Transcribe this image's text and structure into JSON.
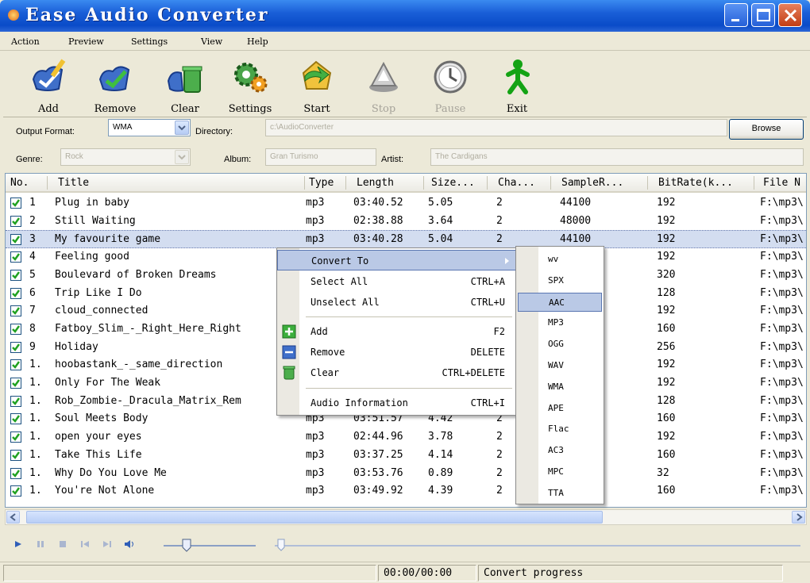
{
  "window": {
    "title": "Ease Audio Converter"
  },
  "menu": [
    "Action",
    "Preview",
    "Settings",
    "View",
    "Help"
  ],
  "toolbar": [
    {
      "label": "Add",
      "icon": "add-icon",
      "enabled": true
    },
    {
      "label": "Remove",
      "icon": "remove-icon",
      "enabled": true
    },
    {
      "label": "Clear",
      "icon": "clear-icon",
      "enabled": true
    },
    {
      "label": "Settings",
      "icon": "settings-icon",
      "enabled": true
    },
    {
      "label": "Start",
      "icon": "start-icon",
      "enabled": true
    },
    {
      "label": "Stop",
      "icon": "stop-icon",
      "enabled": false
    },
    {
      "label": "Pause",
      "icon": "pause-icon",
      "enabled": false
    },
    {
      "label": "Exit",
      "icon": "exit-icon",
      "enabled": true
    }
  ],
  "format": {
    "output_label": "Output Format:",
    "output_value": "WMA",
    "directory_label": "Directory:",
    "directory_value": "c:\\AudioConverter",
    "browse_label": "Browse"
  },
  "tags": {
    "genre_label": "Genre:",
    "genre_value": "Rock",
    "album_label": "Album:",
    "album_value": "Gran Turismo",
    "artist_label": "Artist:",
    "artist_value": "The Cardigans"
  },
  "table": {
    "columns": [
      "No.",
      "Title",
      "Type",
      "Length",
      "Size...",
      "Cha...",
      "SampleR...",
      "BitRate(k...",
      "File N"
    ],
    "rows": [
      {
        "no": "1",
        "title": "Plug in baby",
        "type": "mp3",
        "length": "03:40.52",
        "size": "5.05",
        "ch": "2",
        "sr": "44100",
        "br": "192",
        "file": "F:\\mp3\\"
      },
      {
        "no": "2",
        "title": "Still Waiting",
        "type": "mp3",
        "length": "02:38.88",
        "size": "3.64",
        "ch": "2",
        "sr": "48000",
        "br": "192",
        "file": "F:\\mp3\\"
      },
      {
        "no": "3",
        "title": "My favourite game",
        "type": "mp3",
        "length": "03:40.28",
        "size": "5.04",
        "ch": "2",
        "sr": "44100",
        "br": "192",
        "file": "F:\\mp3\\"
      },
      {
        "no": "4",
        "title": "Feeling good",
        "type": "",
        "length": "",
        "size": "",
        "ch": "",
        "sr": "",
        "br": "192",
        "file": "F:\\mp3\\"
      },
      {
        "no": "5",
        "title": "Boulevard of Broken Dreams",
        "type": "",
        "length": "",
        "size": "",
        "ch": "",
        "sr": "",
        "br": "320",
        "file": "F:\\mp3\\"
      },
      {
        "no": "6",
        "title": "Trip Like I Do",
        "type": "",
        "length": "",
        "size": "",
        "ch": "",
        "sr": "",
        "br": "128",
        "file": "F:\\mp3\\"
      },
      {
        "no": "7",
        "title": "cloud_connected",
        "type": "",
        "length": "",
        "size": "",
        "ch": "",
        "sr": "",
        "br": "192",
        "file": "F:\\mp3\\"
      },
      {
        "no": "8",
        "title": "Fatboy_Slim_-_Right_Here_Right",
        "type": "",
        "length": "",
        "size": "",
        "ch": "",
        "sr": "",
        "br": "160",
        "file": "F:\\mp3\\"
      },
      {
        "no": "9",
        "title": "Holiday",
        "type": "",
        "length": "",
        "size": "",
        "ch": "",
        "sr": "",
        "br": "256",
        "file": "F:\\mp3\\"
      },
      {
        "no": "1.",
        "title": "hoobastank_-_same_direction",
        "type": "",
        "length": "",
        "size": "",
        "ch": "",
        "sr": "",
        "br": "192",
        "file": "F:\\mp3\\"
      },
      {
        "no": "1.",
        "title": "Only For The Weak",
        "type": "",
        "length": "",
        "size": "",
        "ch": "",
        "sr": "",
        "br": "192",
        "file": "F:\\mp3\\"
      },
      {
        "no": "1.",
        "title": "Rob_Zombie-_Dracula_Matrix_Rem",
        "type": "",
        "length": "",
        "size": "",
        "ch": "",
        "sr": "",
        "br": "128",
        "file": "F:\\mp3\\"
      },
      {
        "no": "1.",
        "title": "Soul Meets Body",
        "type": "mp3",
        "length": "03:51.57",
        "size": "4.42",
        "ch": "2",
        "sr": "",
        "br": "160",
        "file": "F:\\mp3\\"
      },
      {
        "no": "1.",
        "title": "open your eyes",
        "type": "mp3",
        "length": "02:44.96",
        "size": "3.78",
        "ch": "2",
        "sr": "",
        "br": "192",
        "file": "F:\\mp3\\"
      },
      {
        "no": "1.",
        "title": "Take This Life",
        "type": "mp3",
        "length": "03:37.25",
        "size": "4.14",
        "ch": "2",
        "sr": "",
        "br": "160",
        "file": "F:\\mp3\\"
      },
      {
        "no": "1.",
        "title": "Why Do You Love Me",
        "type": "mp3",
        "length": "03:53.76",
        "size": "0.89",
        "ch": "2",
        "sr": "",
        "br": "32",
        "file": "F:\\mp3\\"
      },
      {
        "no": "1.",
        "title": "You're Not Alone",
        "type": "mp3",
        "length": "03:49.92",
        "size": "4.39",
        "ch": "2",
        "sr": "",
        "br": "160",
        "file": "F:\\mp3\\"
      }
    ],
    "selected_row": 2
  },
  "context_menu": {
    "items": [
      {
        "label": "Convert To",
        "shortcut": "",
        "icon": "",
        "highlighted": true
      },
      {
        "label": "Select All",
        "shortcut": "CTRL+A",
        "icon": ""
      },
      {
        "label": "Unselect All",
        "shortcut": "CTRL+U",
        "icon": ""
      },
      {
        "label": "Add",
        "shortcut": "F2",
        "icon": "add-icon"
      },
      {
        "label": "Remove",
        "shortcut": "DELETE",
        "icon": "remove-icon"
      },
      {
        "label": "Clear",
        "shortcut": "CTRL+DELETE",
        "icon": "clear-icon"
      },
      {
        "label": "Audio Information",
        "shortcut": "CTRL+I",
        "icon": ""
      }
    ]
  },
  "submenu": {
    "items": [
      "wv",
      "SPX",
      "AAC",
      "MP3",
      "OGG",
      "WAV",
      "WMA",
      "APE",
      "Flac",
      "AC3",
      "MPC",
      "TTA"
    ],
    "highlighted": "AAC"
  },
  "status": {
    "time": "00:00/00:00",
    "progress_label": "Convert progress"
  },
  "colors": {
    "title_bar": "#0a4bc8",
    "selection": "#d3ddf0",
    "menu_highlight": "#bac9e6"
  }
}
